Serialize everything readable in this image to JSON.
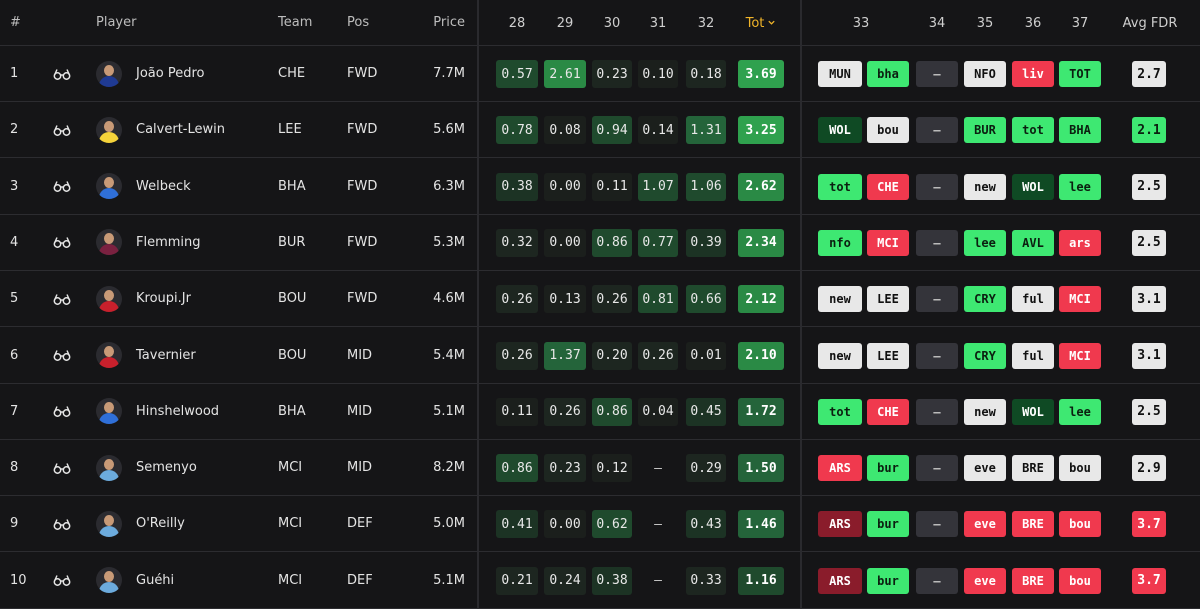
{
  "header": {
    "num": "#",
    "player": "Player",
    "team": "Team",
    "pos": "Pos",
    "price": "Price",
    "gw_points": [
      "28",
      "29",
      "30",
      "31",
      "32"
    ],
    "tot": "Tot",
    "gw_fixtures": [
      "33",
      "34",
      "35",
      "36",
      "37"
    ],
    "avg_fdr": "Avg FDR"
  },
  "colors": {
    "accent": "#f0b429",
    "fixture_easy": "#3ee872",
    "fixture_medium": "#e8e8e8",
    "fixture_hard": "#f0394e",
    "fixture_very_hard": "#8a1c2b",
    "fixture_dark_green": "#0f4a24",
    "blank": "#34343a"
  },
  "players": [
    {
      "num": "1",
      "name": "João Pedro",
      "team": "CHE",
      "pos": "FWD",
      "price": "7.7M",
      "kit": "#1f3a93",
      "points": [
        "0.57",
        "2.61",
        "0.23",
        "0.10",
        "0.18"
      ],
      "tot": "3.69",
      "fixtures": [
        {
          "t": "MUN",
          "c": "m"
        },
        {
          "t": "bha",
          "c": "e"
        },
        {
          "t": "—",
          "c": "b"
        },
        {
          "t": "NFO",
          "c": "m"
        },
        {
          "t": "liv",
          "c": "h"
        },
        {
          "t": "TOT",
          "c": "e"
        }
      ],
      "fdr": "2.7",
      "fdr_c": "m"
    },
    {
      "num": "2",
      "name": "Calvert-Lewin",
      "team": "LEE",
      "pos": "FWD",
      "price": "5.6M",
      "kit": "#f5d33a",
      "points": [
        "0.78",
        "0.08",
        "0.94",
        "0.14",
        "1.31"
      ],
      "tot": "3.25",
      "fixtures": [
        {
          "t": "WOL",
          "c": "d"
        },
        {
          "t": "bou",
          "c": "m"
        },
        {
          "t": "—",
          "c": "b"
        },
        {
          "t": "BUR",
          "c": "e"
        },
        {
          "t": "tot",
          "c": "e"
        },
        {
          "t": "BHA",
          "c": "e"
        }
      ],
      "fdr": "2.1",
      "fdr_c": "e"
    },
    {
      "num": "3",
      "name": "Welbeck",
      "team": "BHA",
      "pos": "FWD",
      "price": "6.3M",
      "kit": "#2f6fd8",
      "points": [
        "0.38",
        "0.00",
        "0.11",
        "1.07",
        "1.06"
      ],
      "tot": "2.62",
      "fixtures": [
        {
          "t": "tot",
          "c": "e"
        },
        {
          "t": "CHE",
          "c": "h"
        },
        {
          "t": "—",
          "c": "b"
        },
        {
          "t": "new",
          "c": "m"
        },
        {
          "t": "WOL",
          "c": "d"
        },
        {
          "t": "lee",
          "c": "e"
        }
      ],
      "fdr": "2.5",
      "fdr_c": "m"
    },
    {
      "num": "4",
      "name": "Flemming",
      "team": "BUR",
      "pos": "FWD",
      "price": "5.3M",
      "kit": "#7a2140",
      "points": [
        "0.32",
        "0.00",
        "0.86",
        "0.77",
        "0.39"
      ],
      "tot": "2.34",
      "fixtures": [
        {
          "t": "nfo",
          "c": "e"
        },
        {
          "t": "MCI",
          "c": "h"
        },
        {
          "t": "—",
          "c": "b"
        },
        {
          "t": "lee",
          "c": "e"
        },
        {
          "t": "AVL",
          "c": "e"
        },
        {
          "t": "ars",
          "c": "h"
        }
      ],
      "fdr": "2.5",
      "fdr_c": "m"
    },
    {
      "num": "5",
      "name": "Kroupi.Jr",
      "team": "BOU",
      "pos": "FWD",
      "price": "4.6M",
      "kit": "#c8202c",
      "points": [
        "0.26",
        "0.13",
        "0.26",
        "0.81",
        "0.66"
      ],
      "tot": "2.12",
      "fixtures": [
        {
          "t": "new",
          "c": "m"
        },
        {
          "t": "LEE",
          "c": "m"
        },
        {
          "t": "—",
          "c": "b"
        },
        {
          "t": "CRY",
          "c": "e"
        },
        {
          "t": "ful",
          "c": "m"
        },
        {
          "t": "MCI",
          "c": "h"
        }
      ],
      "fdr": "3.1",
      "fdr_c": "m"
    },
    {
      "num": "6",
      "name": "Tavernier",
      "team": "BOU",
      "pos": "MID",
      "price": "5.4M",
      "kit": "#c8202c",
      "points": [
        "0.26",
        "1.37",
        "0.20",
        "0.26",
        "0.01"
      ],
      "tot": "2.10",
      "fixtures": [
        {
          "t": "new",
          "c": "m"
        },
        {
          "t": "LEE",
          "c": "m"
        },
        {
          "t": "—",
          "c": "b"
        },
        {
          "t": "CRY",
          "c": "e"
        },
        {
          "t": "ful",
          "c": "m"
        },
        {
          "t": "MCI",
          "c": "h"
        }
      ],
      "fdr": "3.1",
      "fdr_c": "m"
    },
    {
      "num": "7",
      "name": "Hinshelwood",
      "team": "BHA",
      "pos": "MID",
      "price": "5.1M",
      "kit": "#2f6fd8",
      "points": [
        "0.11",
        "0.26",
        "0.86",
        "0.04",
        "0.45"
      ],
      "tot": "1.72",
      "fixtures": [
        {
          "t": "tot",
          "c": "e"
        },
        {
          "t": "CHE",
          "c": "h"
        },
        {
          "t": "—",
          "c": "b"
        },
        {
          "t": "new",
          "c": "m"
        },
        {
          "t": "WOL",
          "c": "d"
        },
        {
          "t": "lee",
          "c": "e"
        }
      ],
      "fdr": "2.5",
      "fdr_c": "m"
    },
    {
      "num": "8",
      "name": "Semenyo",
      "team": "MCI",
      "pos": "MID",
      "price": "8.2M",
      "kit": "#6cabdd",
      "points": [
        "0.86",
        "0.23",
        "0.12",
        "–",
        "0.29"
      ],
      "tot": "1.50",
      "fixtures": [
        {
          "t": "ARS",
          "c": "h"
        },
        {
          "t": "bur",
          "c": "e"
        },
        {
          "t": "—",
          "c": "b"
        },
        {
          "t": "eve",
          "c": "m"
        },
        {
          "t": "BRE",
          "c": "m"
        },
        {
          "t": "bou",
          "c": "m"
        }
      ],
      "fdr": "2.9",
      "fdr_c": "m"
    },
    {
      "num": "9",
      "name": "O'Reilly",
      "team": "MCI",
      "pos": "DEF",
      "price": "5.0M",
      "kit": "#6cabdd",
      "points": [
        "0.41",
        "0.00",
        "0.62",
        "–",
        "0.43"
      ],
      "tot": "1.46",
      "fixtures": [
        {
          "t": "ARS",
          "c": "v"
        },
        {
          "t": "bur",
          "c": "e"
        },
        {
          "t": "—",
          "c": "b"
        },
        {
          "t": "eve",
          "c": "h"
        },
        {
          "t": "BRE",
          "c": "h"
        },
        {
          "t": "bou",
          "c": "h"
        }
      ],
      "fdr": "3.7",
      "fdr_c": "h"
    },
    {
      "num": "10",
      "name": "Guéhi",
      "team": "MCI",
      "pos": "DEF",
      "price": "5.1M",
      "kit": "#6cabdd",
      "points": [
        "0.21",
        "0.24",
        "0.38",
        "–",
        "0.33"
      ],
      "tot": "1.16",
      "fixtures": [
        {
          "t": "ARS",
          "c": "v"
        },
        {
          "t": "bur",
          "c": "e"
        },
        {
          "t": "—",
          "c": "b"
        },
        {
          "t": "eve",
          "c": "h"
        },
        {
          "t": "BRE",
          "c": "h"
        },
        {
          "t": "bou",
          "c": "h"
        }
      ],
      "fdr": "3.7",
      "fdr_c": "h"
    }
  ]
}
